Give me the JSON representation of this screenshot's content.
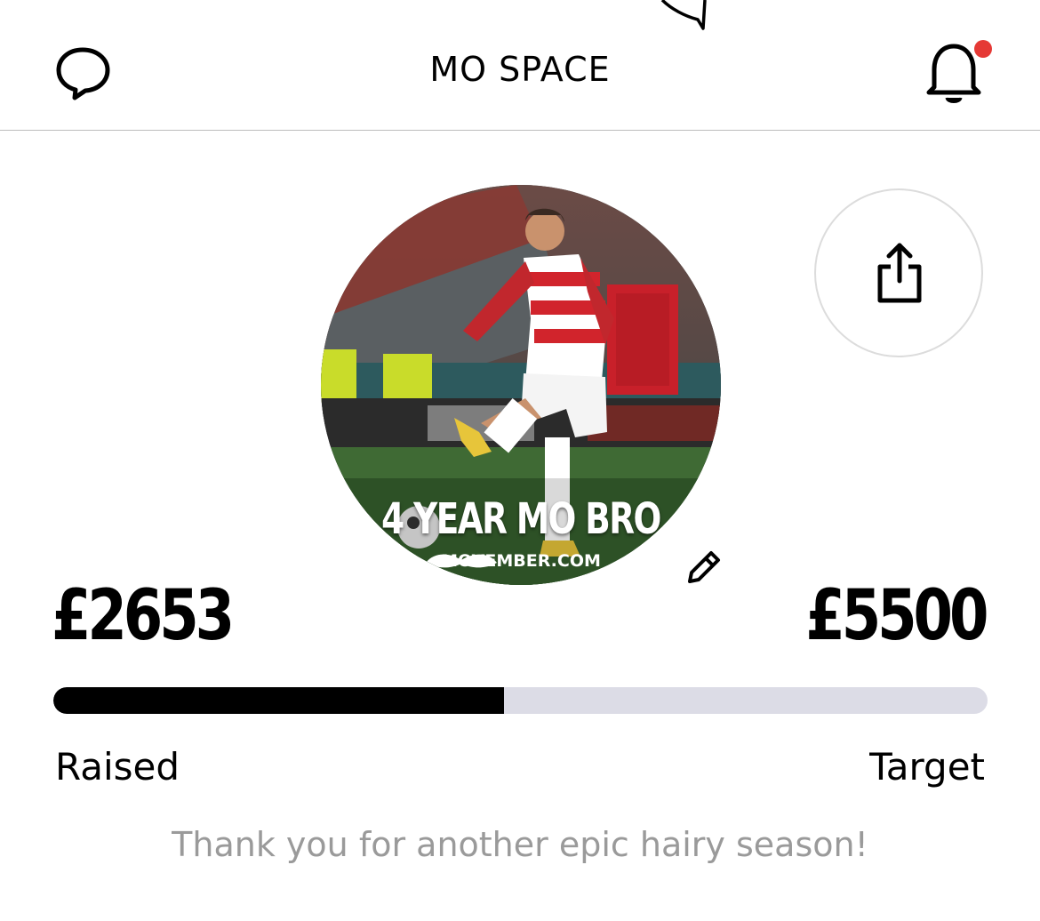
{
  "header": {
    "title": "MO SPACE",
    "chat_icon": "speech-bubble-icon",
    "bell_icon": "bell-icon",
    "notification_dot_color": "#e53935"
  },
  "profile": {
    "photo_caption": "4 YEAR MO BRO",
    "photo_site": "MOVEMBER.COM",
    "edit_icon": "pencil-icon",
    "share_icon": "share-icon"
  },
  "fundraising": {
    "raised": "£2653",
    "target": "£5500",
    "progress_fraction": 0.4824,
    "raised_label": "Raised",
    "target_label": "Target",
    "message": "Thank you for another epic hairy season!"
  }
}
